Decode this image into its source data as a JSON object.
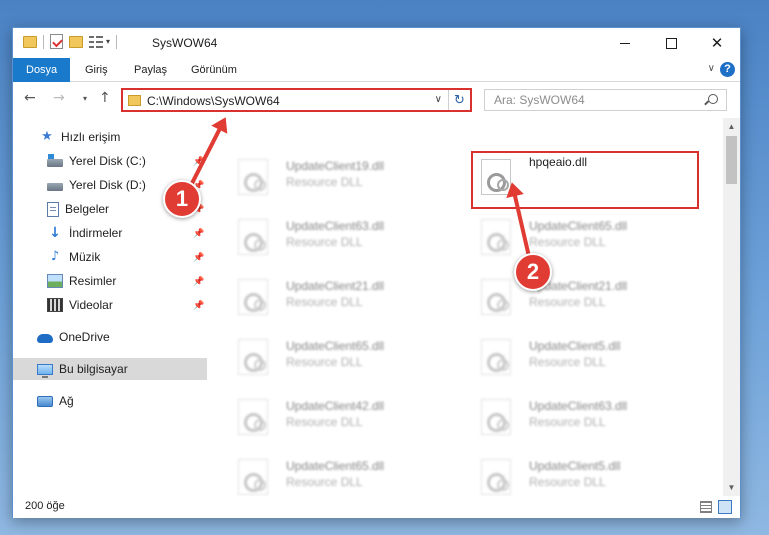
{
  "window": {
    "title": "SysWOW64",
    "controls": {
      "minimize": "minimize",
      "maximize": "maximize",
      "close": "✕"
    }
  },
  "ribbon": {
    "tabs": [
      "Dosya",
      "Giriş",
      "Paylaş",
      "Görünüm"
    ],
    "help": "?"
  },
  "address": {
    "path": "C:\\Windows\\SysWOW64",
    "refresh": "↻"
  },
  "search": {
    "placeholder": "Ara: SysWOW64"
  },
  "sidebar": {
    "items": [
      {
        "label": "Hızlı erişim",
        "icon": "star-icon"
      },
      {
        "label": "Yerel Disk (C:)",
        "icon": "drive-icon",
        "pinned": true
      },
      {
        "label": "Yerel Disk (D:)",
        "icon": "drive-icon",
        "pinned": true
      },
      {
        "label": "Belgeler",
        "icon": "document-icon",
        "pinned": true
      },
      {
        "label": "İndirmeler",
        "icon": "download-icon",
        "pinned": true
      },
      {
        "label": "Müzik",
        "icon": "music-icon",
        "pinned": true
      },
      {
        "label": "Resimler",
        "icon": "pictures-icon",
        "pinned": true
      },
      {
        "label": "Videolar",
        "icon": "video-icon",
        "pinned": true
      },
      {
        "label": "OneDrive",
        "icon": "cloud-icon"
      },
      {
        "label": "Bu bilgisayar",
        "icon": "computer-icon",
        "selected": true
      },
      {
        "label": "Ağ",
        "icon": "network-icon"
      }
    ]
  },
  "files": {
    "type_label": "Resource DLL",
    "left": [
      "UpdateClient19.dll",
      "UpdateClient63.dll",
      "UpdateClient21.dll",
      "UpdateClient65.dll",
      "UpdateClient42.dll",
      "UpdateClient65.dll"
    ],
    "right_highlighted": "hpqeaio.dll",
    "right": [
      "UpdateClient65.dll",
      "UpdateClient21.dll",
      "UpdateClient5.dll",
      "UpdateClient63.dll",
      "UpdateClient5.dll"
    ]
  },
  "status": {
    "count": "200 öğe"
  },
  "annotations": {
    "step1": "1",
    "step2": "2",
    "color": "#e03c34"
  }
}
